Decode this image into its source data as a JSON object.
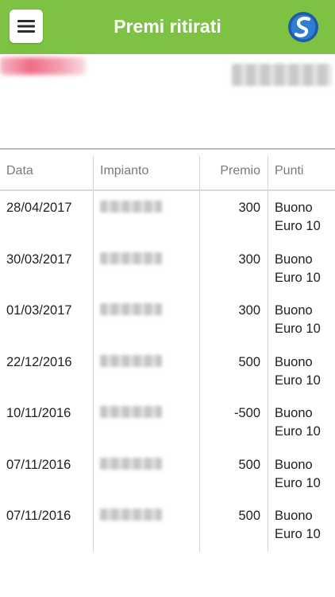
{
  "header": {
    "title": "Premi ritirati",
    "bg_color": "#7dc242"
  },
  "icons": {
    "menu": "hamburger-icon",
    "logo": "brand-logo-icon"
  },
  "table": {
    "columns": [
      "Data",
      "Impianto",
      "Premio",
      "Punti"
    ],
    "rows": [
      {
        "data": "28/04/2017",
        "premio": "300",
        "punti": "Buono Euro 10"
      },
      {
        "data": "30/03/2017",
        "premio": "300",
        "punti": "Buono Euro 10"
      },
      {
        "data": "01/03/2017",
        "premio": "300",
        "punti": "Buono Euro 10"
      },
      {
        "data": "22/12/2016",
        "premio": "500",
        "punti": "Buono Euro 10"
      },
      {
        "data": "10/11/2016",
        "premio": "-500",
        "punti": "Buono Euro 10"
      },
      {
        "data": "07/11/2016",
        "premio": "500",
        "punti": "Buono Euro 10"
      },
      {
        "data": "07/11/2016",
        "premio": "500",
        "punti": "Buono Euro 10"
      }
    ]
  }
}
